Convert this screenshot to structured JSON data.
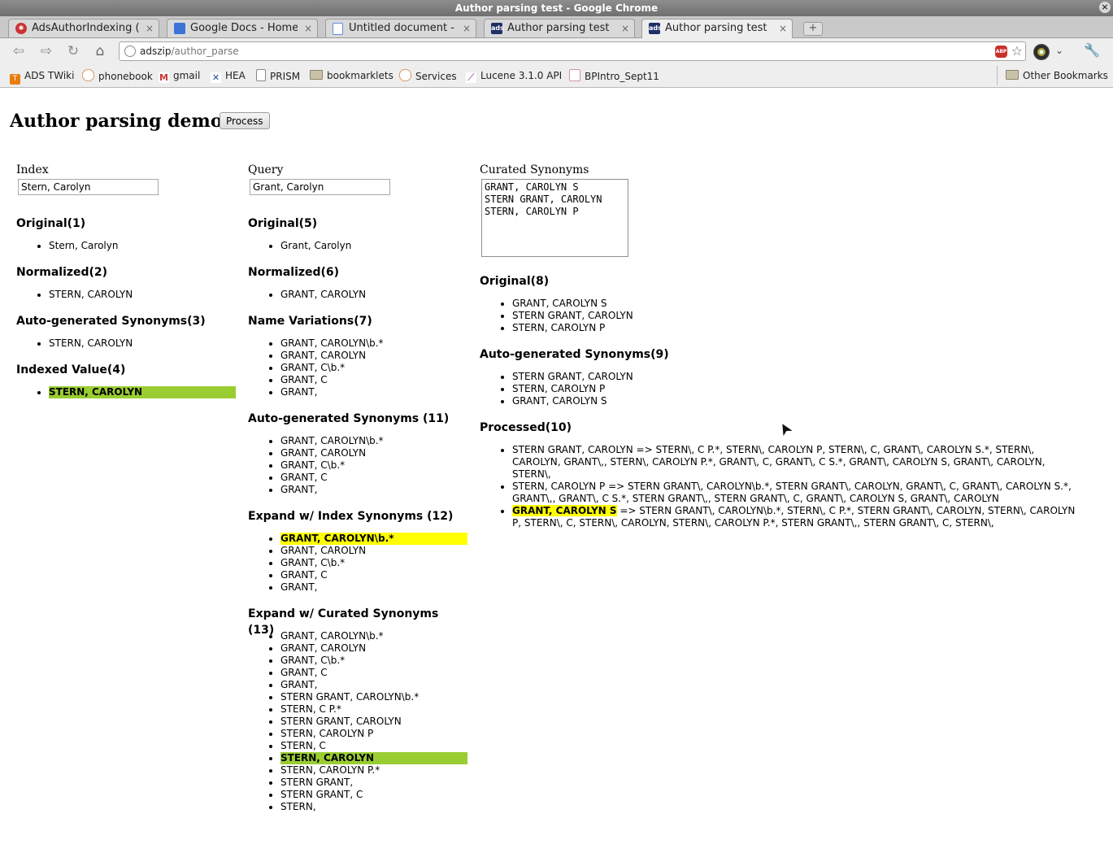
{
  "window": {
    "title": "Author parsing test - Google Chrome",
    "close_label": "×"
  },
  "tabs": [
    {
      "title": "AdsAuthorIndexing (ed",
      "close": "×"
    },
    {
      "title": "Google Docs - Home",
      "close": "×"
    },
    {
      "title": "Untitled document - Go",
      "close": "×"
    },
    {
      "title": "Author parsing test",
      "close": "×"
    },
    {
      "title": "Author parsing test",
      "close": "×"
    }
  ],
  "new_tab_label": "+",
  "toolbar": {
    "url_host": "adszip",
    "url_path": "/author_parse",
    "abp_label": "ABP"
  },
  "bookmarks": [
    {
      "label": "ADS TWiki"
    },
    {
      "label": "phonebook"
    },
    {
      "label": "gmail"
    },
    {
      "label": "HEA"
    },
    {
      "label": "PRISM"
    },
    {
      "label": "bookmarklets"
    },
    {
      "label": "Services"
    },
    {
      "label": "Lucene 3.1.0 API"
    },
    {
      "label": "BPIntro_Sept11"
    },
    {
      "label": "Other Bookmarks"
    }
  ],
  "page": {
    "title": "Author parsing demo",
    "process_button": "Process",
    "index": {
      "label": "Index",
      "value": "Stern, Carolyn",
      "sections": [
        {
          "heading": "Original(1)",
          "items": [
            "Stern, Carolyn"
          ]
        },
        {
          "heading": "Normalized(2)",
          "items": [
            "STERN, CAROLYN"
          ]
        },
        {
          "heading": "Auto-generated Synonyms(3)",
          "items": [
            "STERN, CAROLYN"
          ]
        },
        {
          "heading": "Indexed Value(4)",
          "items": [
            "STERN, CAROLYN"
          ]
        }
      ]
    },
    "query": {
      "label": "Query",
      "value": "Grant, Carolyn",
      "sections": [
        {
          "heading": "Original(5)",
          "items": [
            "Grant, Carolyn"
          ]
        },
        {
          "heading": "Normalized(6)",
          "items": [
            "GRANT, CAROLYN"
          ]
        },
        {
          "heading": "Name Variations(7)",
          "items": [
            "GRANT, CAROLYN\\b.*",
            "GRANT, CAROLYN",
            "GRANT, C\\b.*",
            "GRANT, C",
            "GRANT,"
          ]
        },
        {
          "heading": "Auto-generated Synonyms (11)",
          "items": [
            "GRANT, CAROLYN\\b.*",
            "GRANT, CAROLYN",
            "GRANT, C\\b.*",
            "GRANT, C",
            "GRANT,"
          ]
        },
        {
          "heading": "Expand w/ Index Synonyms (12)",
          "items": [
            "GRANT, CAROLYN\\b.*",
            "GRANT, CAROLYN",
            "GRANT, C\\b.*",
            "GRANT, C",
            "GRANT,"
          ]
        },
        {
          "heading": "Expand w/ Curated Synonyms (13)",
          "items": [
            "GRANT, CAROLYN\\b.*",
            "GRANT, CAROLYN",
            "GRANT, C\\b.*",
            "GRANT, C",
            "GRANT,",
            "STERN GRANT, CAROLYN\\b.*",
            "STERN, C P.*",
            "STERN GRANT, CAROLYN",
            "STERN, CAROLYN P",
            "STERN, C",
            "STERN, CAROLYN",
            "STERN, CAROLYN P.*",
            "STERN GRANT,",
            "STERN GRANT, C",
            "STERN,"
          ]
        }
      ]
    },
    "curated": {
      "label": "Curated Synonyms",
      "textarea": "GRANT, CAROLYN S\nSTERN GRANT, CAROLYN\nSTERN, CAROLYN P",
      "sections": [
        {
          "heading": "Original(8)",
          "items": [
            "GRANT, CAROLYN S",
            "STERN GRANT, CAROLYN",
            "STERN, CAROLYN P"
          ]
        },
        {
          "heading": "Auto-generated Synonyms(9)",
          "items": [
            "STERN GRANT, CAROLYN",
            "STERN, CAROLYN P",
            "GRANT, CAROLYN S"
          ]
        },
        {
          "heading": "Processed(10)",
          "items": [
            "STERN GRANT, CAROLYN => STERN\\, C P.*, STERN\\, CAROLYN P, STERN\\, C, GRANT\\, CAROLYN S.*, STERN\\, CAROLYN, GRANT\\,, STERN\\, CAROLYN P.*, GRANT\\, C, GRANT\\, C S.*, GRANT\\, CAROLYN S, GRANT\\, CAROLYN, STERN\\,",
            "STERN, CAROLYN P => STERN GRANT\\, CAROLYN\\b.*, STERN GRANT\\, CAROLYN, GRANT\\, C, GRANT\\, CAROLYN S.*, GRANT\\,, GRANT\\, C S.*, STERN GRANT\\,, STERN GRANT\\, C, GRANT\\, CAROLYN S, GRANT\\, CAROLYN",
            "=> STERN GRANT\\, CAROLYN\\b.*, STERN\\, C P.*, STERN GRANT\\, CAROLYN, STERN\\, CAROLYN P, STERN\\, C, STERN\\, CAROLYN, STERN\\, CAROLYN P.*, STERN GRANT\\,, STERN GRANT\\, C, STERN\\,"
          ],
          "highlight_prefix": "GRANT, CAROLYN S"
        }
      ]
    }
  },
  "colors": {
    "yellow_highlight": "#ffff00",
    "green_highlight": "#9acd32"
  }
}
